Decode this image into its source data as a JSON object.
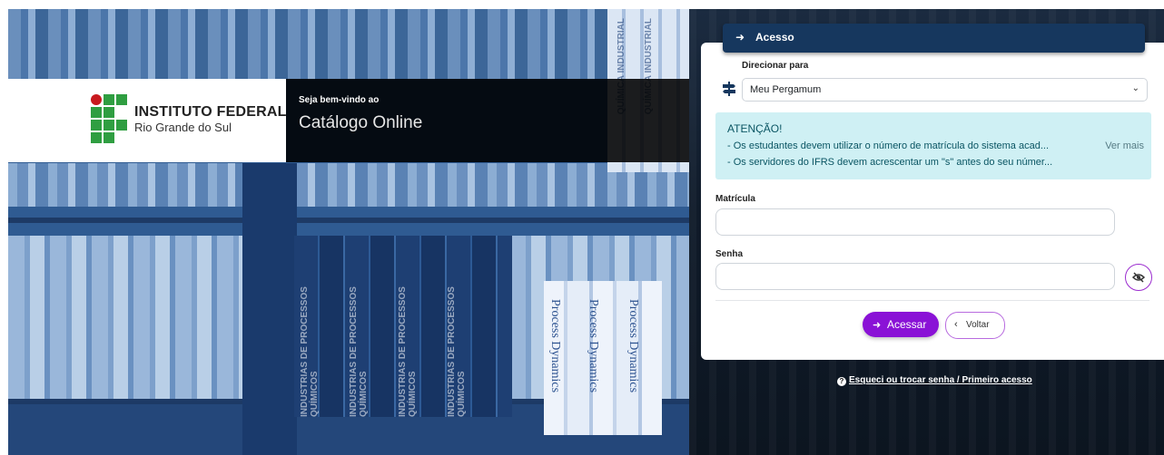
{
  "institution": {
    "name": "INSTITUTO FEDERAL",
    "campus": "Rio Grande do Sul"
  },
  "welcome": {
    "greeting": "Seja bem-vindo ao",
    "catalog": "Catálogo Online"
  },
  "login": {
    "header_title": "Acesso",
    "redirect_label": "Direcionar para",
    "redirect_value": "Meu Pergamum",
    "alert": {
      "heading": "ATENÇÃO!",
      "line1": "- Os estudantes devem utilizar o número de matrícula do sistema acad...",
      "line2": "- Os servidores do IFRS devem acrescentar um \"s\" antes do seu númer...",
      "more": "Ver mais"
    },
    "matricula_label": "Matrícula",
    "senha_label": "Senha",
    "submit_label": "Acessar",
    "back_label": "Voltar",
    "forgot_link": "Esqueci ou trocar senha / Primeiro acesso"
  },
  "background_spines": [
    "INDUSTRIAS DE PROCESSOS QUÍMICOS",
    "Process Dynamics",
    "QUÍMICA INDUSTRIAL"
  ],
  "colors": {
    "header_bar": "#16375e",
    "primary_button": "#8a12d6",
    "alert_bg": "#cff0f4",
    "logo_green": "#2f9e41",
    "logo_red": "#c8191e"
  }
}
